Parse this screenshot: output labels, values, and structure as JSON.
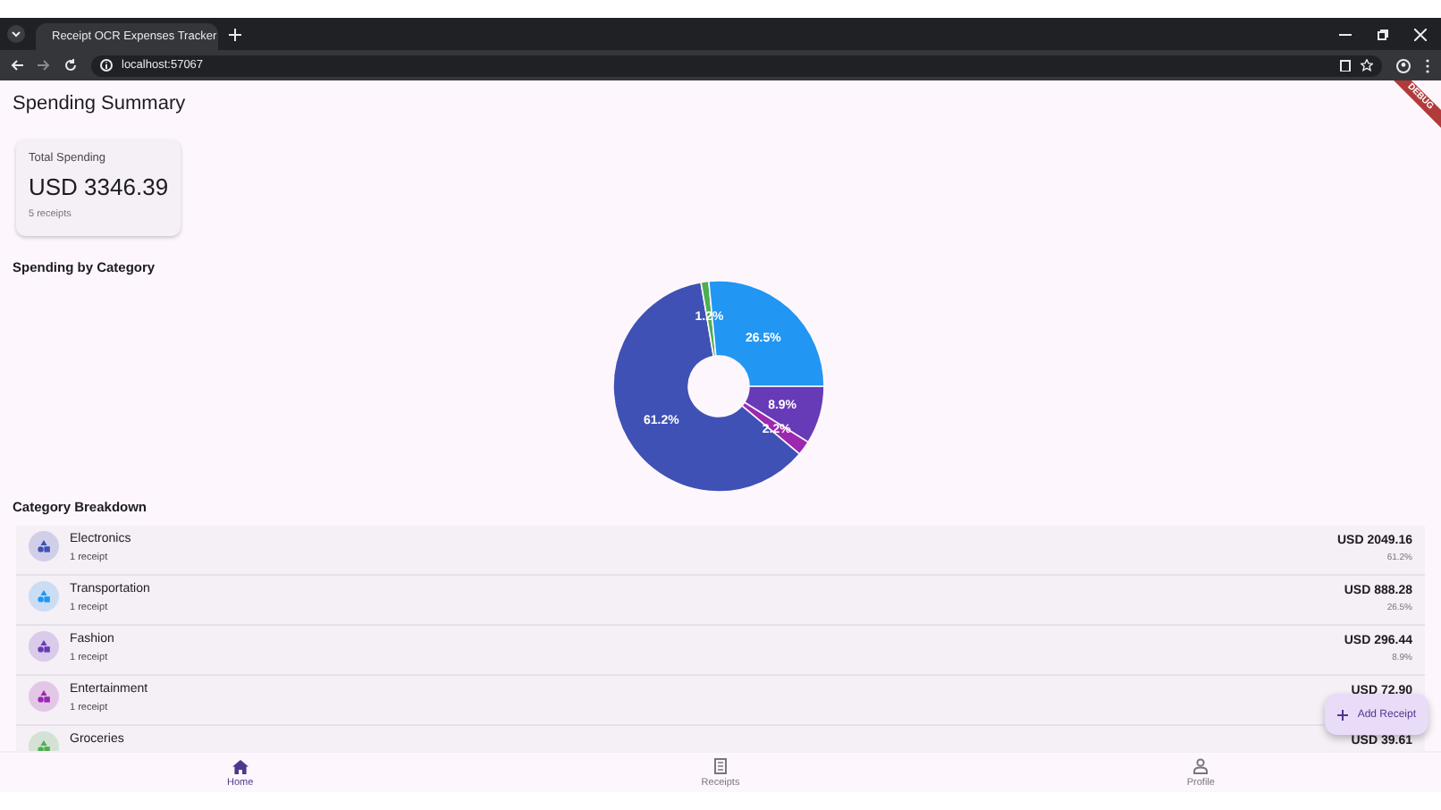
{
  "browser": {
    "tab_title": "Receipt OCR Expenses Tracker",
    "address": "localhost:57067"
  },
  "debug_banner": "DEBUG",
  "title": "Spending Summary",
  "summary": {
    "label": "Total Spending",
    "total": "USD 3346.39",
    "count": "5 receipts"
  },
  "chart_section": {
    "title": "Spending by Category",
    "chart_data": {
      "type": "donut",
      "values": [
        8.9,
        2.2,
        61.2,
        1.2,
        26.5
      ],
      "colors": [
        "#673ab7",
        "#9c27b0",
        "#3f51b5",
        "#4caf50",
        "#2196f3"
      ],
      "value_labels": [
        "8.9%",
        "2.2%",
        "61.2%",
        "1.2%",
        "26.5%"
      ]
    }
  },
  "breakdown": {
    "title": "Category Breakdown",
    "items": [
      {
        "name": "Electronics",
        "count": "1 receipt",
        "amount": "USD 2049.16",
        "percent": "61.2%",
        "color": "#3f51b5"
      },
      {
        "name": "Transportation",
        "count": "1 receipt",
        "amount": "USD 888.28",
        "percent": "26.5%",
        "color": "#2196f3"
      },
      {
        "name": "Fashion",
        "count": "1 receipt",
        "amount": "USD 296.44",
        "percent": "8.9%",
        "color": "#673ab7"
      },
      {
        "name": "Entertainment",
        "count": "1 receipt",
        "amount": "USD 72.90",
        "color": "#9c27b0"
      },
      {
        "name": "Groceries",
        "amount": "USD 39.61",
        "color": "#4caf50"
      }
    ]
  },
  "fab": {
    "label": "Add Receipt"
  },
  "nav": [
    {
      "label": "Home",
      "kind": "home",
      "selected": true
    },
    {
      "label": "Receipts",
      "kind": "receipts",
      "selected": false
    },
    {
      "label": "Profile",
      "kind": "profile",
      "selected": false
    }
  ]
}
